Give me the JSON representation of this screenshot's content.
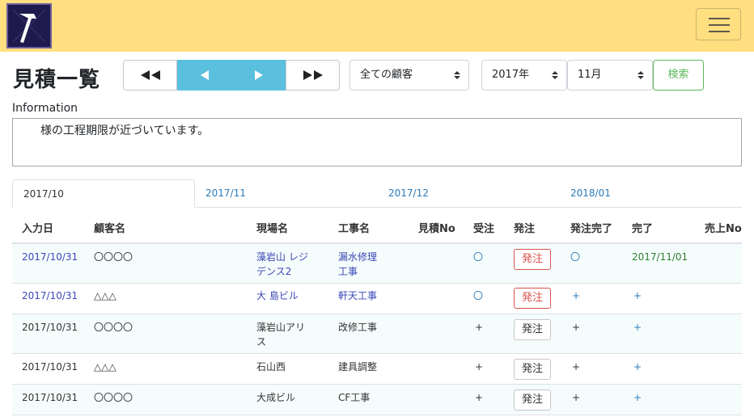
{
  "page": {
    "title": "見積一覧",
    "info_label": "Information",
    "info_text": "様の工程期限が近づいています。"
  },
  "pager": {
    "first": "◀◀",
    "prev": "◀",
    "next": "▶",
    "last": "▶▶"
  },
  "filters": {
    "customer": "全ての顧客",
    "year": "2017年",
    "month": "11月",
    "search_label": "検索"
  },
  "tabs": [
    "2017/10",
    "2017/11",
    "2017/12",
    "2018/01"
  ],
  "columns": [
    "入力日",
    "顧客名",
    "現場名",
    "工事名",
    "見積No",
    "受注",
    "発注",
    "発注完了",
    "完了",
    "売上No"
  ],
  "rows": [
    {
      "date": "2017/10/31",
      "customer": "〇〇〇〇",
      "site": "藻岩山 レジデンス2",
      "work": "漏水修理工事",
      "estimate_no": "",
      "received": "〇",
      "order_label": "発注",
      "order_complete": "〇",
      "complete": "2017/11/01",
      "sales_no": ""
    },
    {
      "date": "2017/10/31",
      "customer": "△△△",
      "site": "大 島ビル",
      "work": "軒天工事",
      "estimate_no": "",
      "received": "〇",
      "order_label": "発注",
      "order_complete": "+",
      "complete": "+",
      "sales_no": ""
    },
    {
      "date": "2017/10/31",
      "customer": "〇〇〇〇",
      "site": "藻岩山アリス",
      "work": "改修工事",
      "estimate_no": "",
      "received": "+",
      "order_label": "発注",
      "order_complete": "+",
      "complete": "+",
      "sales_no": ""
    },
    {
      "date": "2017/10/31",
      "customer": "△△△",
      "site": "石山西",
      "work": "建具調整",
      "estimate_no": "",
      "received": "+",
      "order_label": "発注",
      "order_complete": "+",
      "complete": "+",
      "sales_no": ""
    },
    {
      "date": "2017/10/31",
      "customer": "〇〇〇〇",
      "site": "大成ビル",
      "work": "CF工事",
      "estimate_no": "",
      "received": "+",
      "order_label": "発注",
      "order_complete": "+",
      "complete": "+",
      "sales_no": ""
    }
  ],
  "colors": {
    "navbar": "#ffdf80",
    "pager_active": "#5bc0de",
    "search_button": "#5cb85c",
    "order_highlight": "#d9534f",
    "link": "#3a47b6"
  },
  "icons": [
    "hammer-logo-icon",
    "menu-icon",
    "double-left-arrow-icon",
    "left-arrow-icon",
    "right-arrow-icon",
    "double-right-arrow-icon",
    "select-caret-icon"
  ]
}
